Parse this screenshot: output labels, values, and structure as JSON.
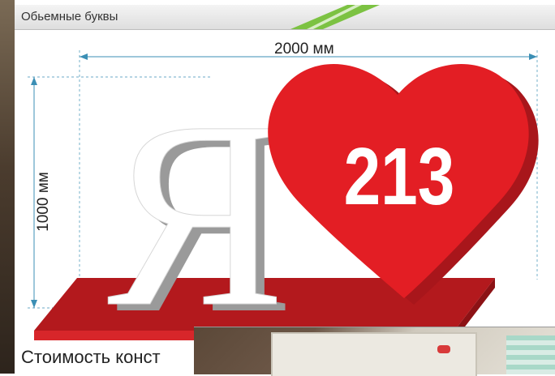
{
  "header": {
    "title": "Обьемные буквы"
  },
  "dimensions": {
    "width_label": "2000 мм",
    "height_label": "1000 мм"
  },
  "sign": {
    "letter": "Я",
    "heart_text": "213"
  },
  "footer": {
    "cost_text": "Стоимость конст"
  },
  "colors": {
    "heart": "#e31e24",
    "heart_side": "#a8161b",
    "base_top": "#b3191d",
    "base_front": "#d7262a",
    "letter_face": "#ffffff",
    "letter_shadow": "#9a9a9a"
  }
}
